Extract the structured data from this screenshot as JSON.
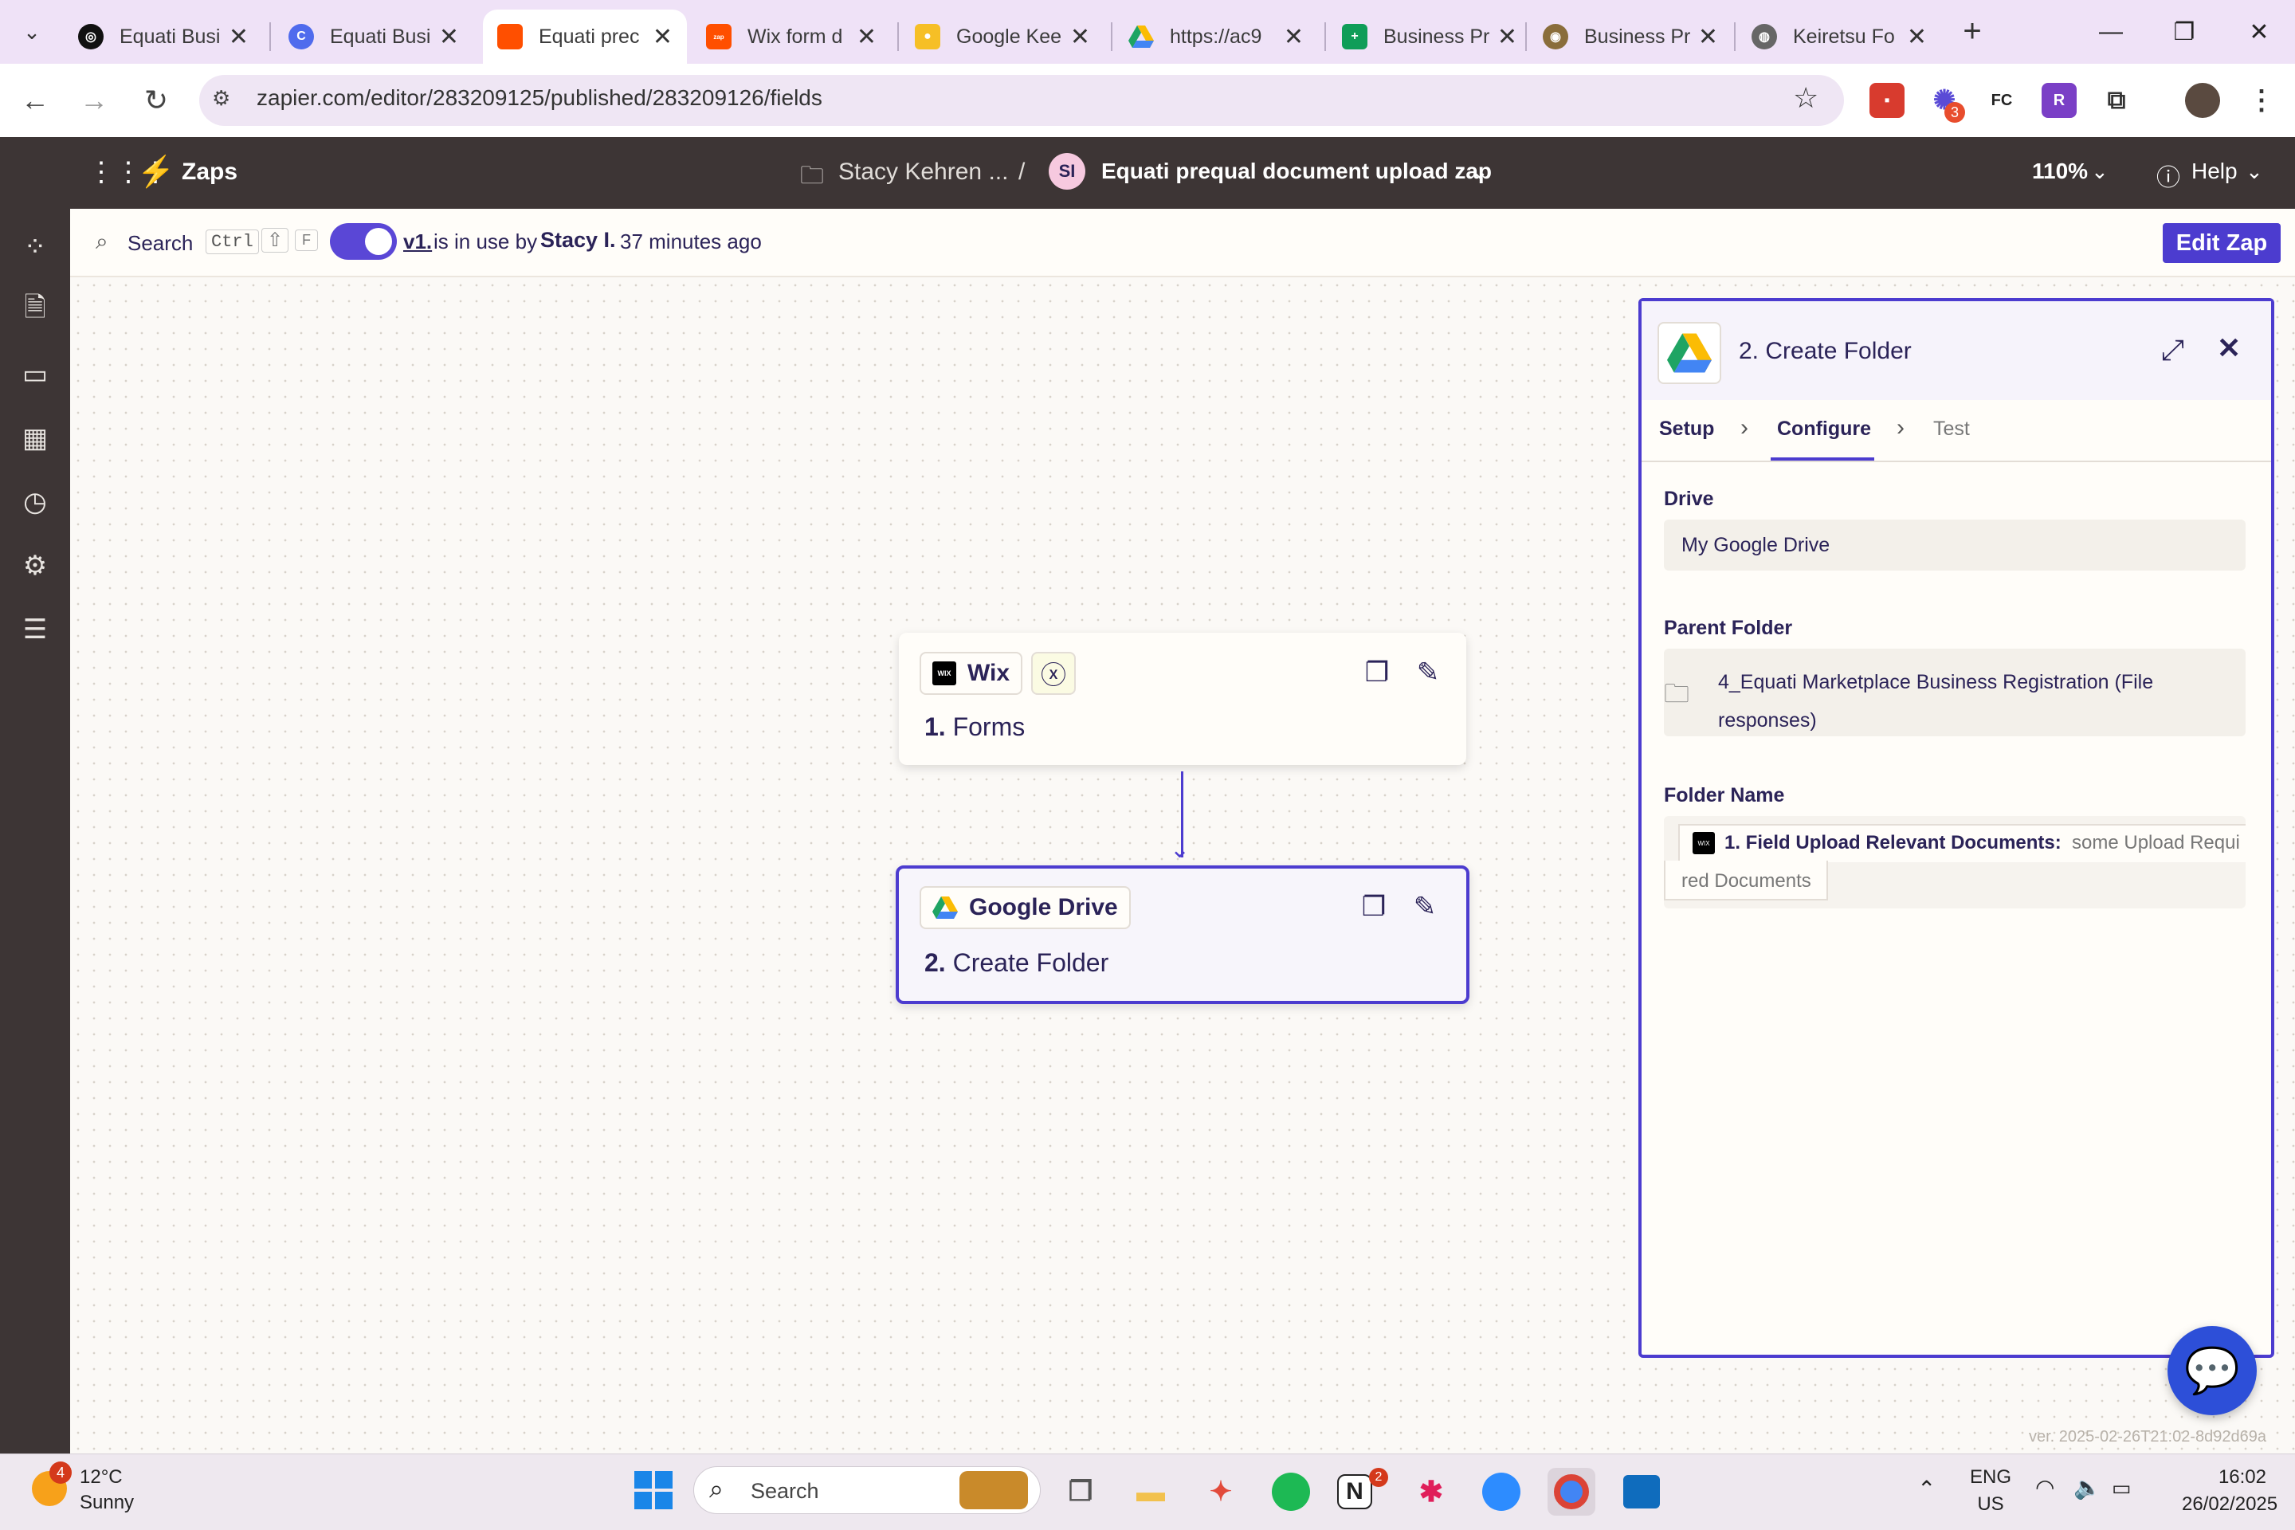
{
  "browser": {
    "tabs": [
      {
        "title": "Equati Busi",
        "icon": "openai-icon",
        "color": "#111111"
      },
      {
        "title": "Equati Busi",
        "icon": "copilot-icon",
        "color": "#4f6bed"
      },
      {
        "title": "Equati prec",
        "icon": "zapier-icon",
        "color": "#ff4f00"
      },
      {
        "title": "Wix form d",
        "icon": "zapier-icon",
        "color": "#ff4f00"
      },
      {
        "title": "Google Kee",
        "icon": "keep-icon",
        "color": "#f6bf26"
      },
      {
        "title": "https://ac9",
        "icon": "drive-icon",
        "color": "#1fa463"
      },
      {
        "title": "Business Pr",
        "icon": "sheets-icon",
        "color": "#0f9d58"
      },
      {
        "title": "Business Pr",
        "icon": "app-icon",
        "color": "#8a6d3b"
      },
      {
        "title": "Keiretsu Fo",
        "icon": "globe-icon",
        "color": "#666666"
      }
    ],
    "url": "zapier.com/editor/283209125/published/283209126/fields",
    "extensions": [
      "FC",
      "R"
    ],
    "ext_badge": "3"
  },
  "header": {
    "app_name": "Zaps",
    "folder": "Stacy Kehren ...",
    "separator": "/",
    "avatar": "SI",
    "zap_title": "Equati prequal document upload zap",
    "zoom": "110%",
    "help": "Help"
  },
  "subbar": {
    "search": "Search",
    "keys": [
      "Ctrl",
      "⇧",
      "F"
    ],
    "version": "v1.",
    "status_prefix": "is in use by",
    "user": "Stacy I.",
    "time": "37 minutes ago",
    "edit_button": "Edit Zap"
  },
  "steps": [
    {
      "app": "Wix",
      "number": "1.",
      "title": "Forms"
    },
    {
      "app": "Google Drive",
      "number": "2.",
      "title": "Create Folder"
    }
  ],
  "panel": {
    "title": "2. Create Folder",
    "tabs": [
      "Setup",
      "Configure",
      "Test"
    ],
    "active_tab": "Configure",
    "fields": {
      "drive_label": "Drive",
      "drive_value": "My Google Drive",
      "parent_label": "Parent Folder",
      "parent_value_line1": "4_Equati Marketplace Business Registration (File",
      "parent_value_line2": "responses)",
      "folder_label": "Folder Name",
      "folder_pill_label": "1. Field Upload Relevant Documents:",
      "folder_pill_value_line1": "some Upload Requi",
      "folder_pill_value_line2": "red Documents"
    }
  },
  "version_stamp": "ver. 2025-02-26T21:02-8d92d69a",
  "taskbar": {
    "weather_temp": "12°C",
    "weather_desc": "Sunny",
    "weather_badge": "4",
    "search": "Search",
    "lang1": "ENG",
    "lang2": "US",
    "time": "16:02",
    "date": "26/02/2025",
    "notion_badge": "2"
  },
  "colors": {
    "accent": "#4c3ccf",
    "header_bg": "#3d3535",
    "zapier_orange": "#ff4f00"
  }
}
